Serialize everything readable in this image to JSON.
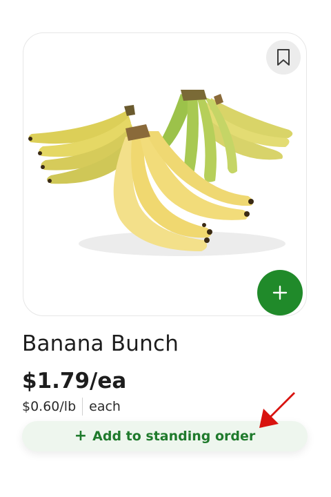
{
  "product": {
    "name": "Banana Bunch",
    "price": "$1.79/ea",
    "unit_price": "$0.60/lb",
    "unit_type": "each",
    "image_subject": "bunches of yellow and green bananas"
  },
  "actions": {
    "bookmark_icon": "bookmark-icon",
    "add_icon": "plus-icon",
    "standing_order_plus": "+",
    "standing_order_label": "Add to standing order"
  },
  "colors": {
    "accent_green": "#208a2a",
    "standing_order_bg": "#eef6ee",
    "standing_order_text": "#1f7a2c",
    "annotation_arrow": "#d8130f"
  }
}
